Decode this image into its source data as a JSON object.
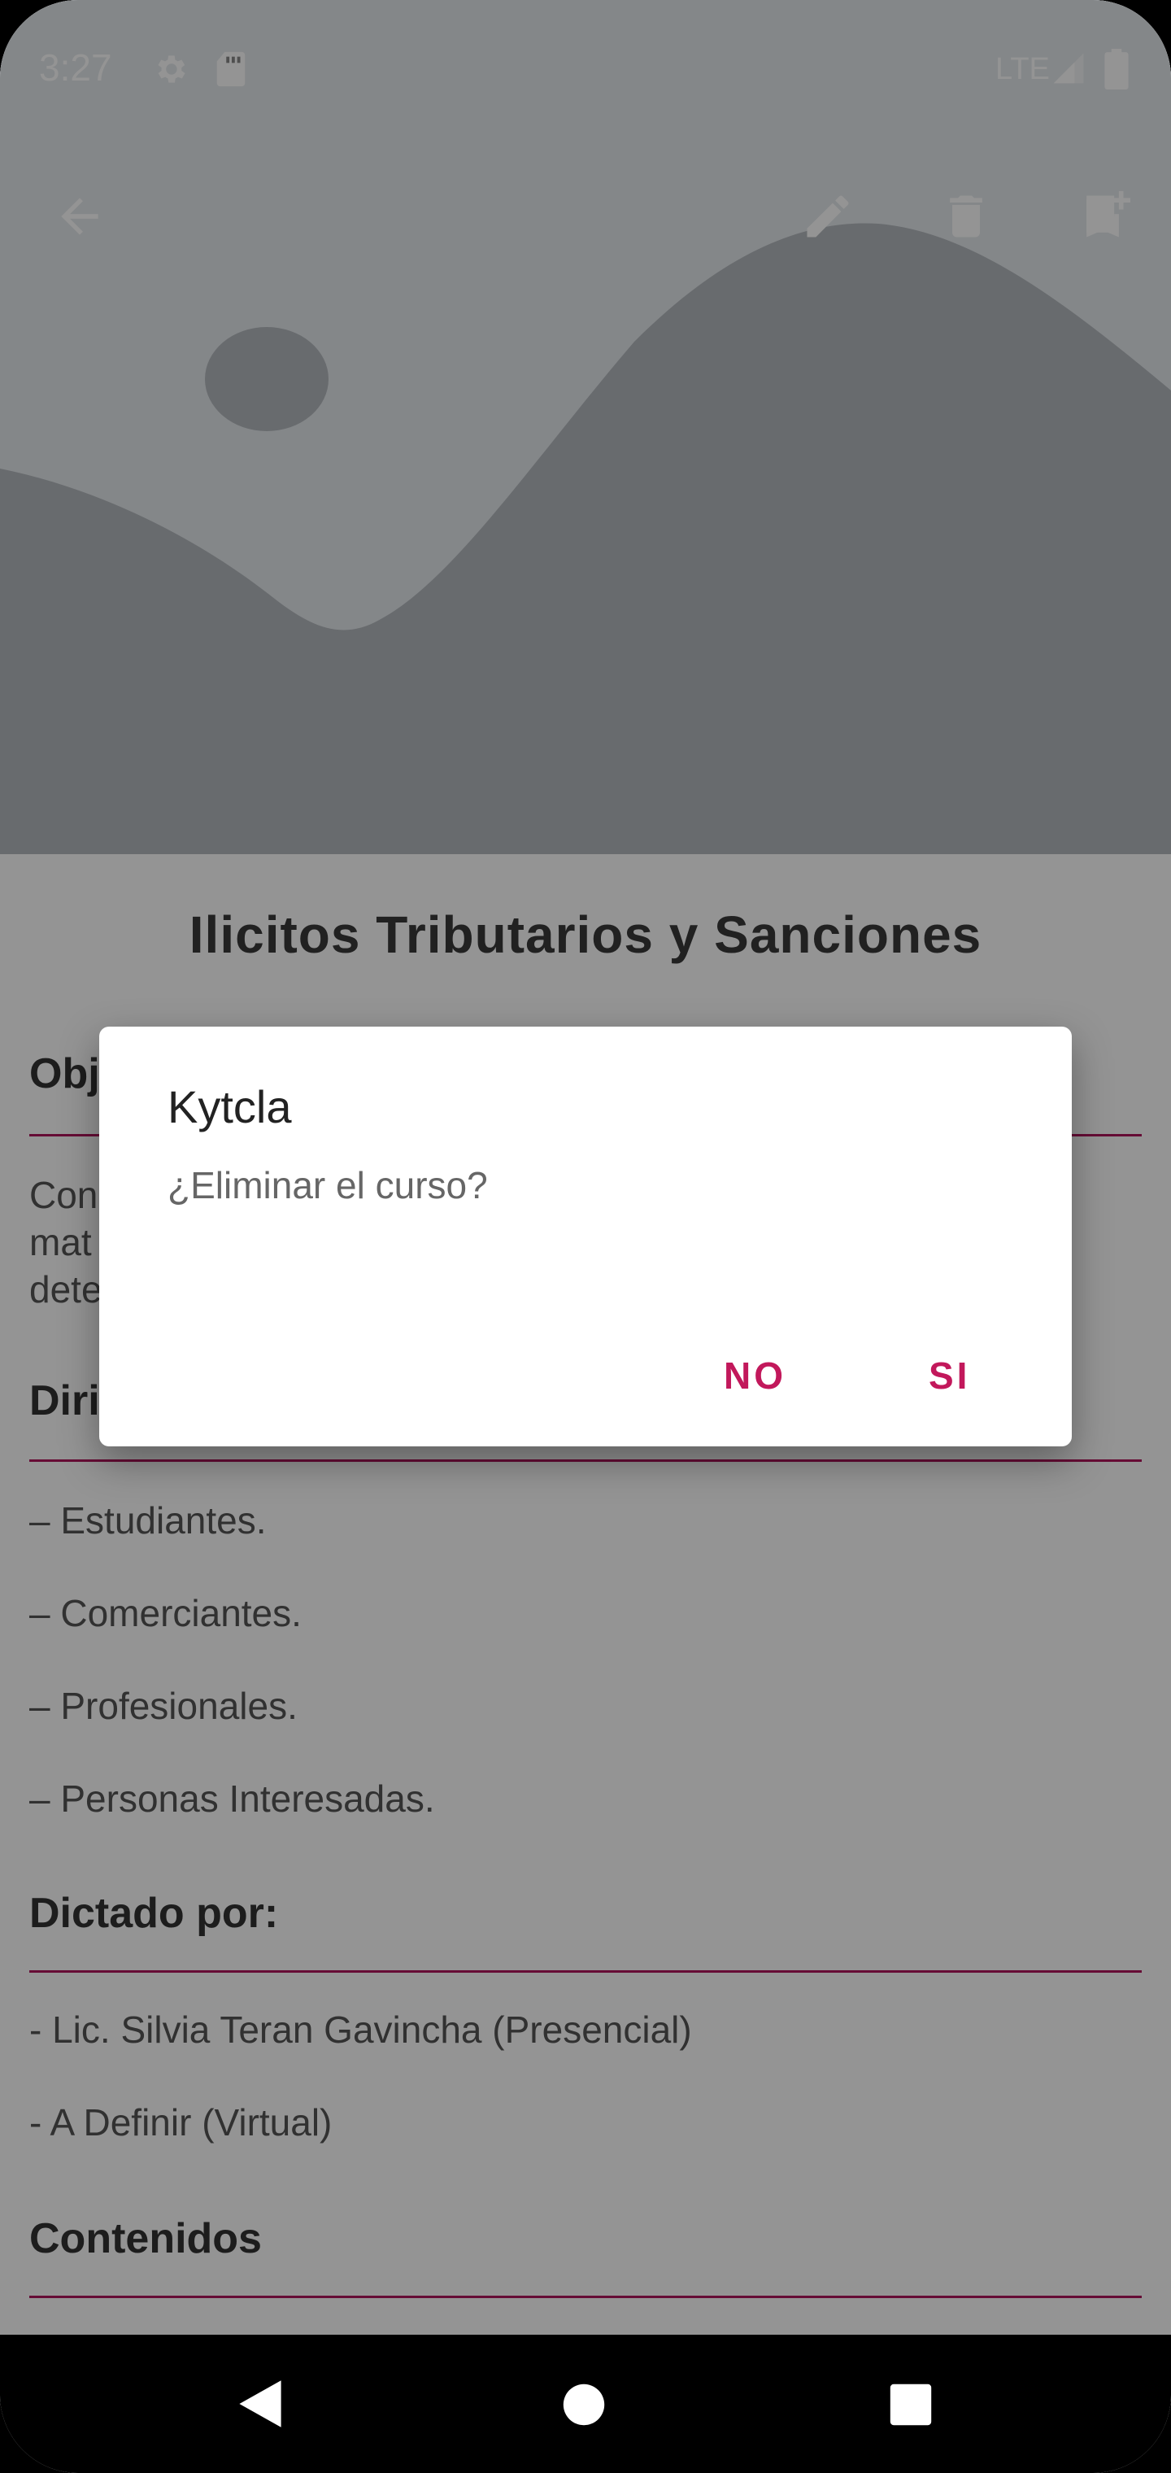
{
  "status_bar": {
    "time": "3:27",
    "network": "LTE",
    "icons": [
      "gear-icon",
      "sd-card-icon",
      "signal-icon",
      "battery-icon"
    ]
  },
  "toolbar": {
    "icons": [
      "back-arrow-icon",
      "edit-icon",
      "delete-icon",
      "bookmark-add-icon"
    ]
  },
  "course": {
    "title": "Ilicitos Tributarios y Sanciones",
    "objective_heading_partial": "Obj",
    "objective_text_partial": [
      "Con",
      "mat",
      "dete"
    ],
    "directed_heading_partial": "Diri",
    "directed_items": [
      "– Estudiantes.",
      "– Comerciantes.",
      "– Profesionales.",
      "– Personas Interesadas."
    ],
    "dictated_heading": "Dictado por:",
    "dictated_items": [
      "- Lic. Silvia Teran Gavincha (Presencial)",
      "- A Definir (Virtual)"
    ],
    "contents_heading": "Contenidos"
  },
  "dialog": {
    "title": "Kytcla",
    "message": "¿Eliminar el curso?",
    "negative_label": "NO",
    "positive_label": "SI"
  },
  "colors": {
    "accent": "#c2185b",
    "rule": "#b0155c",
    "placeholder_bg": "#e4e8ec",
    "placeholder_shape": "#b3b8bd"
  },
  "nav_bar": {
    "icons": [
      "back-triangle-icon",
      "home-circle-icon",
      "recents-square-icon"
    ]
  }
}
